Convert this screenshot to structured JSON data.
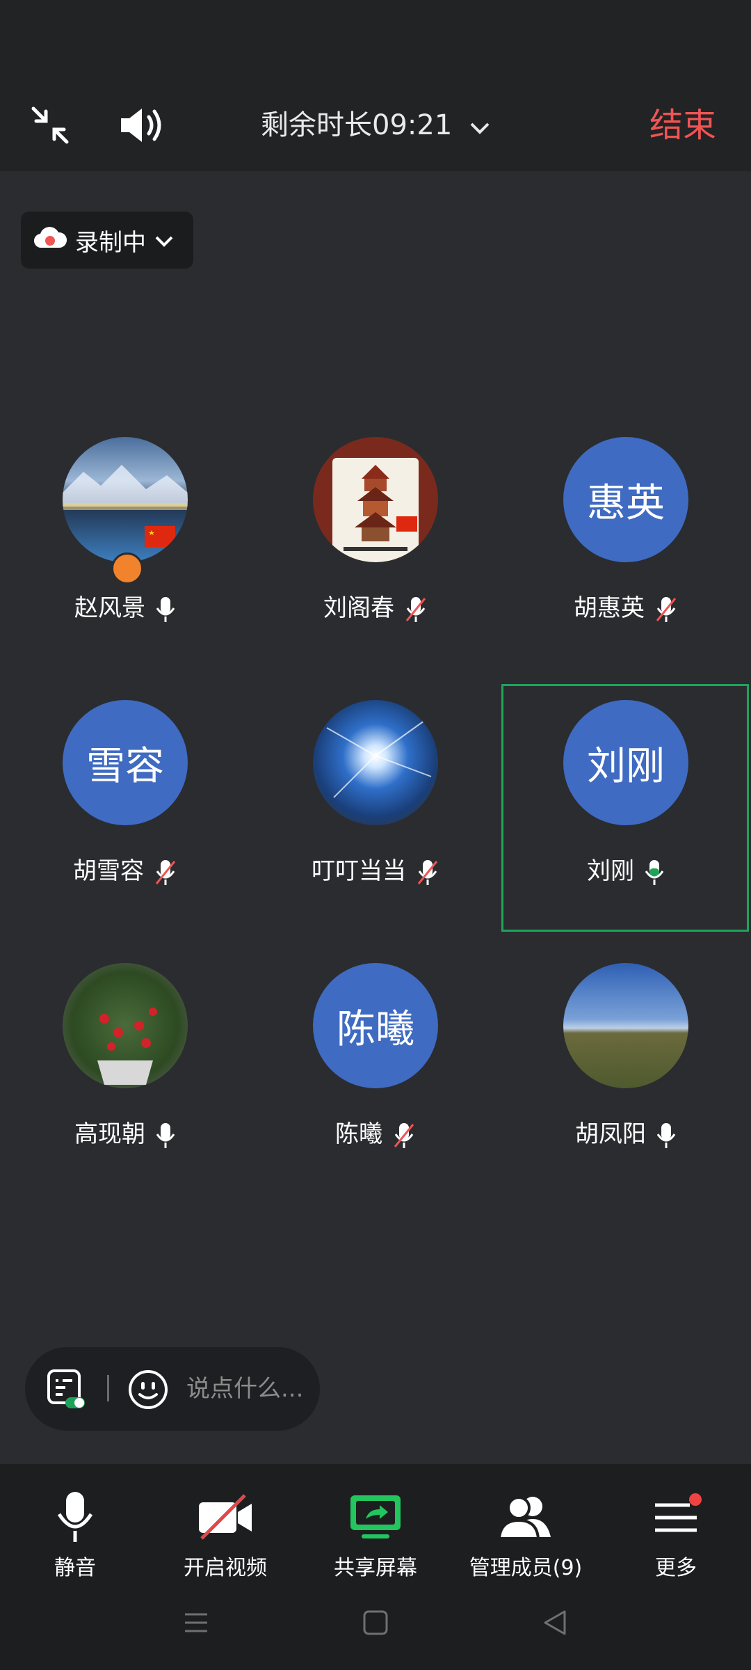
{
  "header": {
    "timer_text": "剩余时长09:21",
    "end_label": "结束"
  },
  "recording": {
    "label": "录制中"
  },
  "members": [
    {
      "name": "赵风景",
      "avatar_type": "photo-lake",
      "mic": "on",
      "host": true
    },
    {
      "name": "刘阁春",
      "avatar_type": "photo-pagoda",
      "mic": "muted",
      "host": false
    },
    {
      "name": "胡惠英",
      "avatar_type": "text",
      "avatar_text": "惠英",
      "mic": "muted",
      "host": false
    },
    {
      "name": "胡雪容",
      "avatar_type": "text",
      "avatar_text": "雪容",
      "mic": "muted",
      "host": false
    },
    {
      "name": "叮叮当当",
      "avatar_type": "photo-sun",
      "mic": "muted",
      "host": false
    },
    {
      "name": "刘刚",
      "avatar_type": "text",
      "avatar_text": "刘刚",
      "mic": "speaking",
      "host": false,
      "active": true
    },
    {
      "name": "高现朝",
      "avatar_type": "photo-berries",
      "mic": "on",
      "host": false
    },
    {
      "name": "陈曦",
      "avatar_type": "text",
      "avatar_text": "陈曦",
      "mic": "muted",
      "host": false
    },
    {
      "name": "胡凤阳",
      "avatar_type": "photo-grassland",
      "mic": "on",
      "host": false
    }
  ],
  "chat": {
    "placeholder": "说点什么..."
  },
  "toolbar": [
    {
      "label": "静音",
      "icon": "mic-icon"
    },
    {
      "label": "开启视频",
      "icon": "video-off-icon"
    },
    {
      "label": "共享屏幕",
      "icon": "share-screen-icon"
    },
    {
      "label": "管理成员(9)",
      "icon": "members-icon"
    },
    {
      "label": "更多",
      "icon": "more-menu-icon"
    }
  ],
  "colors": {
    "accent_red": "#f05454",
    "avatar_blue": "#3f6bc2",
    "speaking_green": "#1fa35a",
    "share_green": "#22c55e"
  }
}
